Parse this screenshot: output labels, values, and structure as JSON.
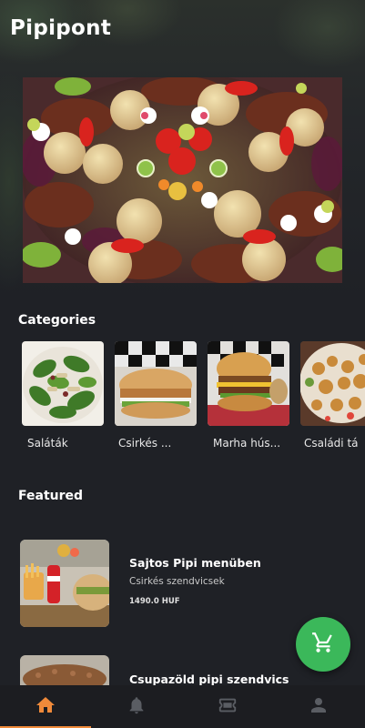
{
  "app": {
    "title": "Pipipont"
  },
  "sections": {
    "categories_title": "Categories",
    "featured_title": "Featured"
  },
  "categories": [
    {
      "label": "Saláták"
    },
    {
      "label": "Csirkés ..."
    },
    {
      "label": "Marha hús..."
    },
    {
      "label": "Családi tá"
    }
  ],
  "featured": [
    {
      "name": "Sajtos Pipi menüben",
      "category": "Csirkés szendvicsek",
      "price": "1490.0 HUF"
    },
    {
      "name": "Csupazöld pipi szendvics",
      "category": "",
      "price": ""
    }
  ],
  "nav": {
    "items": [
      {
        "icon": "home-icon",
        "active": true
      },
      {
        "icon": "bell-icon",
        "active": false
      },
      {
        "icon": "ticket-icon",
        "active": false
      },
      {
        "icon": "person-icon",
        "active": false
      }
    ]
  },
  "colors": {
    "background": "#1f2126",
    "accent": "#f08a3a",
    "cart": "#3bb85a",
    "nav_inactive": "#5a5d63"
  },
  "cart": {
    "icon": "cart-icon"
  }
}
